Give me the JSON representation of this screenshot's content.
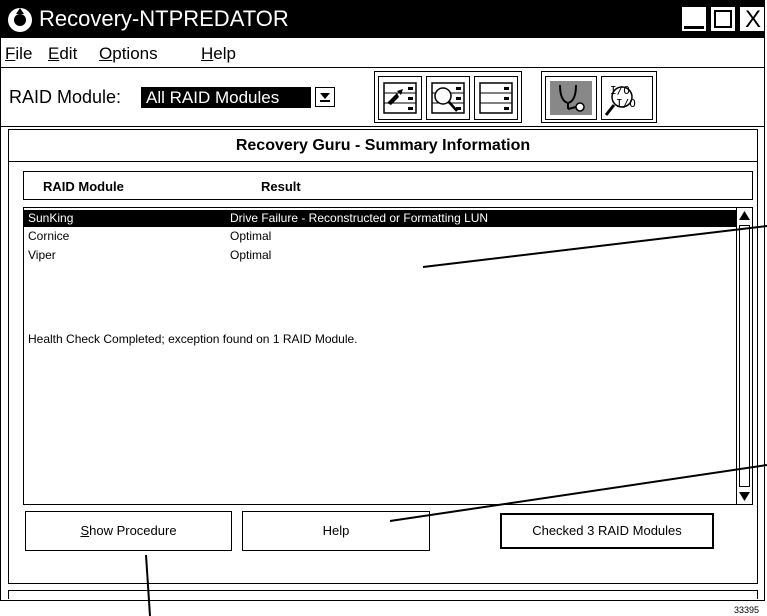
{
  "window": {
    "title": "Recovery-NTPREDATOR",
    "close_glyph": "X"
  },
  "menu": {
    "items": [
      {
        "accel": "F",
        "rest": "ile"
      },
      {
        "accel": "E",
        "rest": "dit"
      },
      {
        "accel": "O",
        "rest": "ptions"
      },
      {
        "accel": "H",
        "rest": "elp"
      }
    ]
  },
  "toolbar": {
    "raid_label": "RAID Module:",
    "raid_selected": "All RAID Modules",
    "icons": [
      "configuration-icon",
      "status-icon",
      "recovery-icon",
      "maintenance-icon",
      "raid-module-icon"
    ],
    "icon_texts": [
      "I/O",
      "I/O"
    ]
  },
  "panel": {
    "title": "Recovery Guru - Summary Information",
    "columns": [
      "RAID Module",
      "Result"
    ],
    "rows": [
      {
        "module": "SunKing",
        "result": "Drive Failure - Reconstructed or Formatting LUN",
        "selected": true
      },
      {
        "module": "Cornice",
        "result": "Optimal",
        "selected": false
      },
      {
        "module": "Viper",
        "result": "Optimal",
        "selected": false
      }
    ],
    "health_message": "Health Check Completed; exception found on 1 RAID Module."
  },
  "buttons": {
    "show_procedure_accel": "S",
    "show_procedure_rest": "how Procedure",
    "help": "Help",
    "status": "Checked 3 RAID Modules"
  },
  "figure_number": "33395",
  "colors": {
    "foreground": "#000000",
    "background": "#ffffff"
  }
}
